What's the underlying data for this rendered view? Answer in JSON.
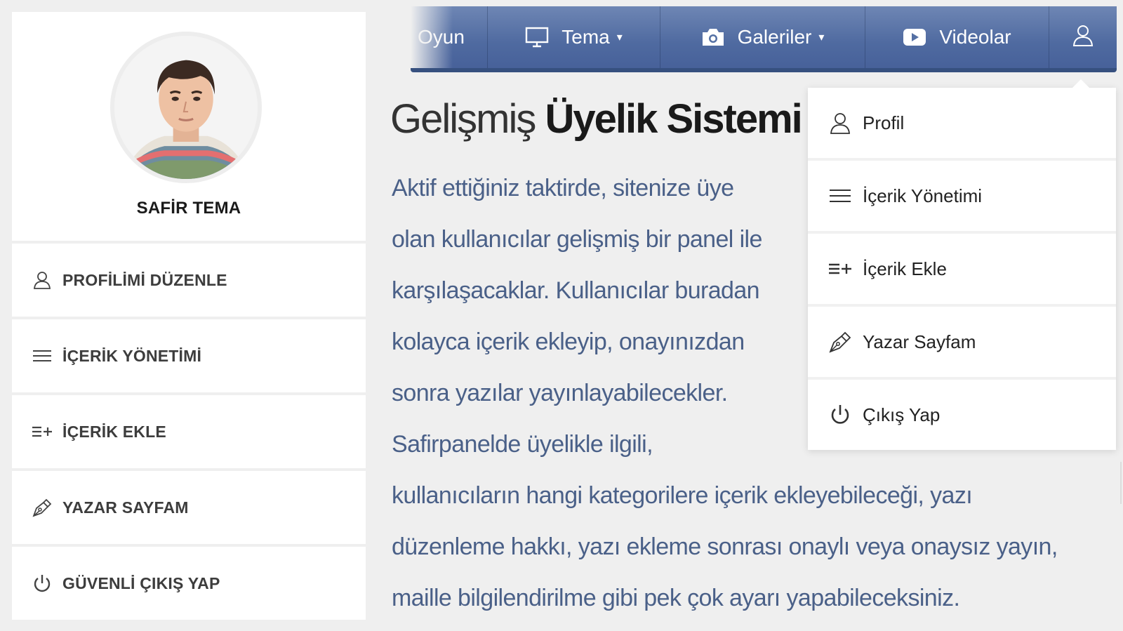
{
  "profile": {
    "name": "SAFİR TEMA",
    "menu": [
      {
        "label": "PROFİLİMİ DÜZENLE",
        "icon": "user-icon"
      },
      {
        "label": "İÇERİK YÖNETİMİ",
        "icon": "menu-lines-icon"
      },
      {
        "label": "İÇERİK EKLE",
        "icon": "add-content-icon"
      },
      {
        "label": "YAZAR SAYFAM",
        "icon": "pen-icon"
      },
      {
        "label": "GÜVENLİ ÇIKIŞ YAP",
        "icon": "power-icon"
      }
    ]
  },
  "nav": {
    "items": [
      {
        "label": "Oyun",
        "icon": ""
      },
      {
        "label": "Tema",
        "icon": "monitor-icon",
        "caret": "▾"
      },
      {
        "label": "Galeriler",
        "icon": "camera-icon",
        "caret": "▾"
      },
      {
        "label": "Videolar",
        "icon": "video-play-icon"
      }
    ],
    "user_icon": "user-icon"
  },
  "main": {
    "title_light": "Gelişmiş ",
    "title_bold": "Üyelik Sistemi !",
    "paragraph_lines": [
      "Aktif ettiğiniz taktirde, sitenize üye",
      "olan kullanıcılar gelişmiş bir  panel ile",
      "karşılaşacaklar. Kullanıcılar buradan",
      "kolayca içerik ekleyip, onayınızdan",
      "sonra  yazılar yayınlayabilecekler.",
      "Safirpanelde üyelikle ilgili,",
      "kullanıcıların hangi kategorilere içerik ekleyebileceği, yazı",
      "düzenleme hakkı, yazı ekleme sonrası onaylı veya onaysız yayın,",
      "maille bilgilendirilme gibi pek çok  ayarı yapabileceksiniz."
    ]
  },
  "dropdown": {
    "items": [
      {
        "label": "Profil",
        "icon": "user-icon"
      },
      {
        "label": "İçerik Yönetimi",
        "icon": "menu-lines-icon"
      },
      {
        "label": "İçerik Ekle",
        "icon": "add-content-icon"
      },
      {
        "label": "Yazar Sayfam",
        "icon": "pen-icon"
      },
      {
        "label": "Çıkış Yap",
        "icon": "power-icon"
      }
    ]
  },
  "colors": {
    "nav_bg": "#4f6aa0",
    "text_accent": "#4a6088",
    "card_bg": "#ffffff",
    "page_bg": "#efefef"
  }
}
